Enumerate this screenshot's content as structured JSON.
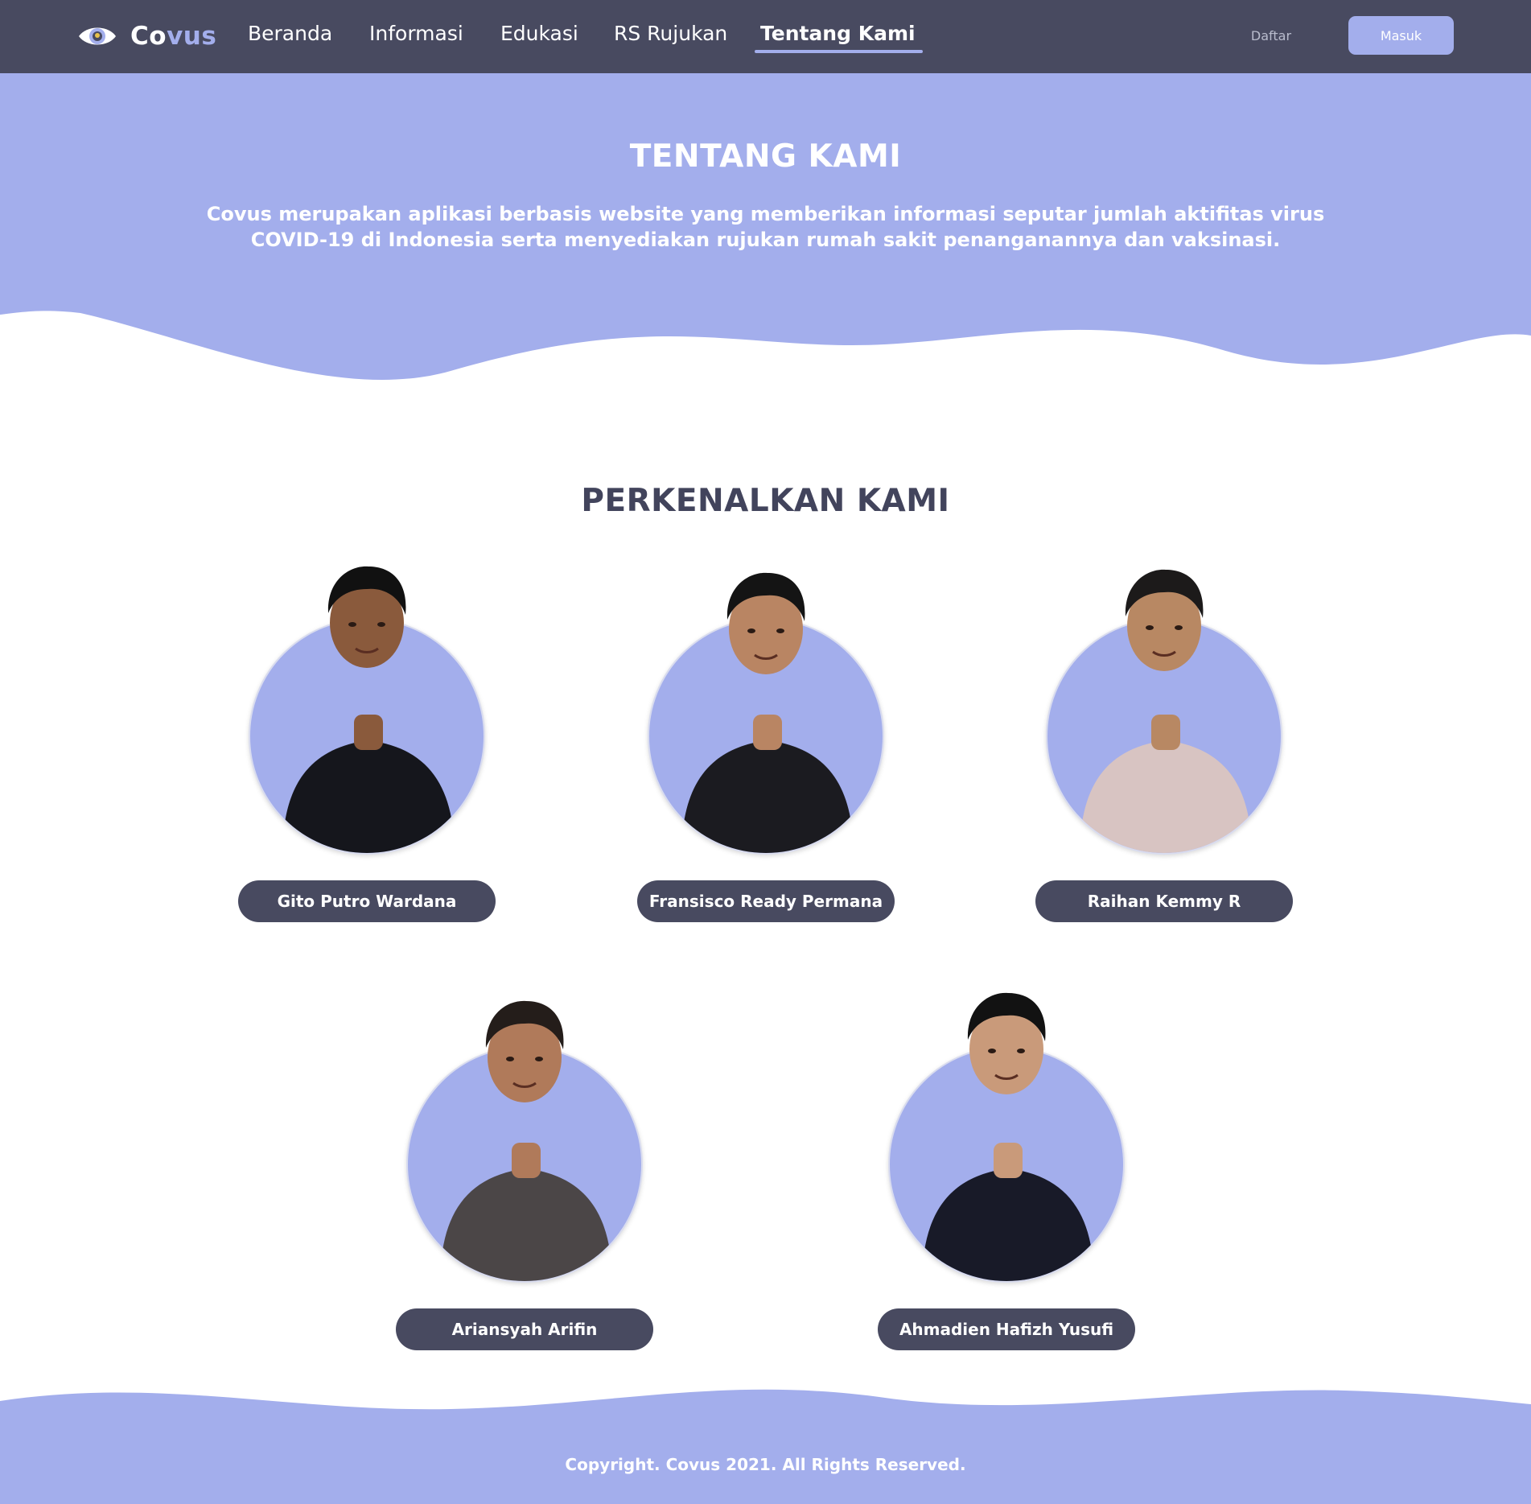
{
  "nav": {
    "logo_part1": "Co",
    "logo_part2": "vus",
    "links": [
      "Beranda",
      "Informasi",
      "Edukasi",
      "RS Rujukan",
      "Tentang Kami"
    ],
    "active": "Tentang Kami",
    "register_label": "Daftar",
    "login_label": "Masuk"
  },
  "hero": {
    "title": "TENTANG KAMI",
    "description": "Covus merupakan aplikasi berbasis website yang memberikan informasi seputar jumlah aktifitas virus COVID-19 di Indonesia serta menyediakan rujukan rumah sakit penanganannya dan vaksinasi."
  },
  "team": {
    "title": "PERKENALKAN KAMI",
    "members": [
      {
        "name": "Gito Putro Wardana",
        "shirt": "#15161c",
        "skin": "#8a5a3c",
        "hair": "#111111"
      },
      {
        "name": "Fransisco Ready Permana",
        "shirt": "#1b1b20",
        "skin": "#b98563",
        "hair": "#141414"
      },
      {
        "name": "Raihan Kemmy R",
        "shirt": "#d8c4c2",
        "skin": "#b88863",
        "hair": "#1c1a1a"
      },
      {
        "name": "Ariansyah Arifin",
        "shirt": "#4b4647",
        "skin": "#b07a5a",
        "hair": "#241d1a"
      },
      {
        "name": "Ahmadien Hafizh Yusufi",
        "shirt": "#181a28",
        "skin": "#c99a7a",
        "hair": "#121212"
      }
    ]
  },
  "footer": {
    "copyright": "Copyright. Covus 2021. All Rights Reserved."
  },
  "colors": {
    "nav_bg": "#484a60",
    "accent": "#a3aeec",
    "pill_bg": "#484a60"
  }
}
